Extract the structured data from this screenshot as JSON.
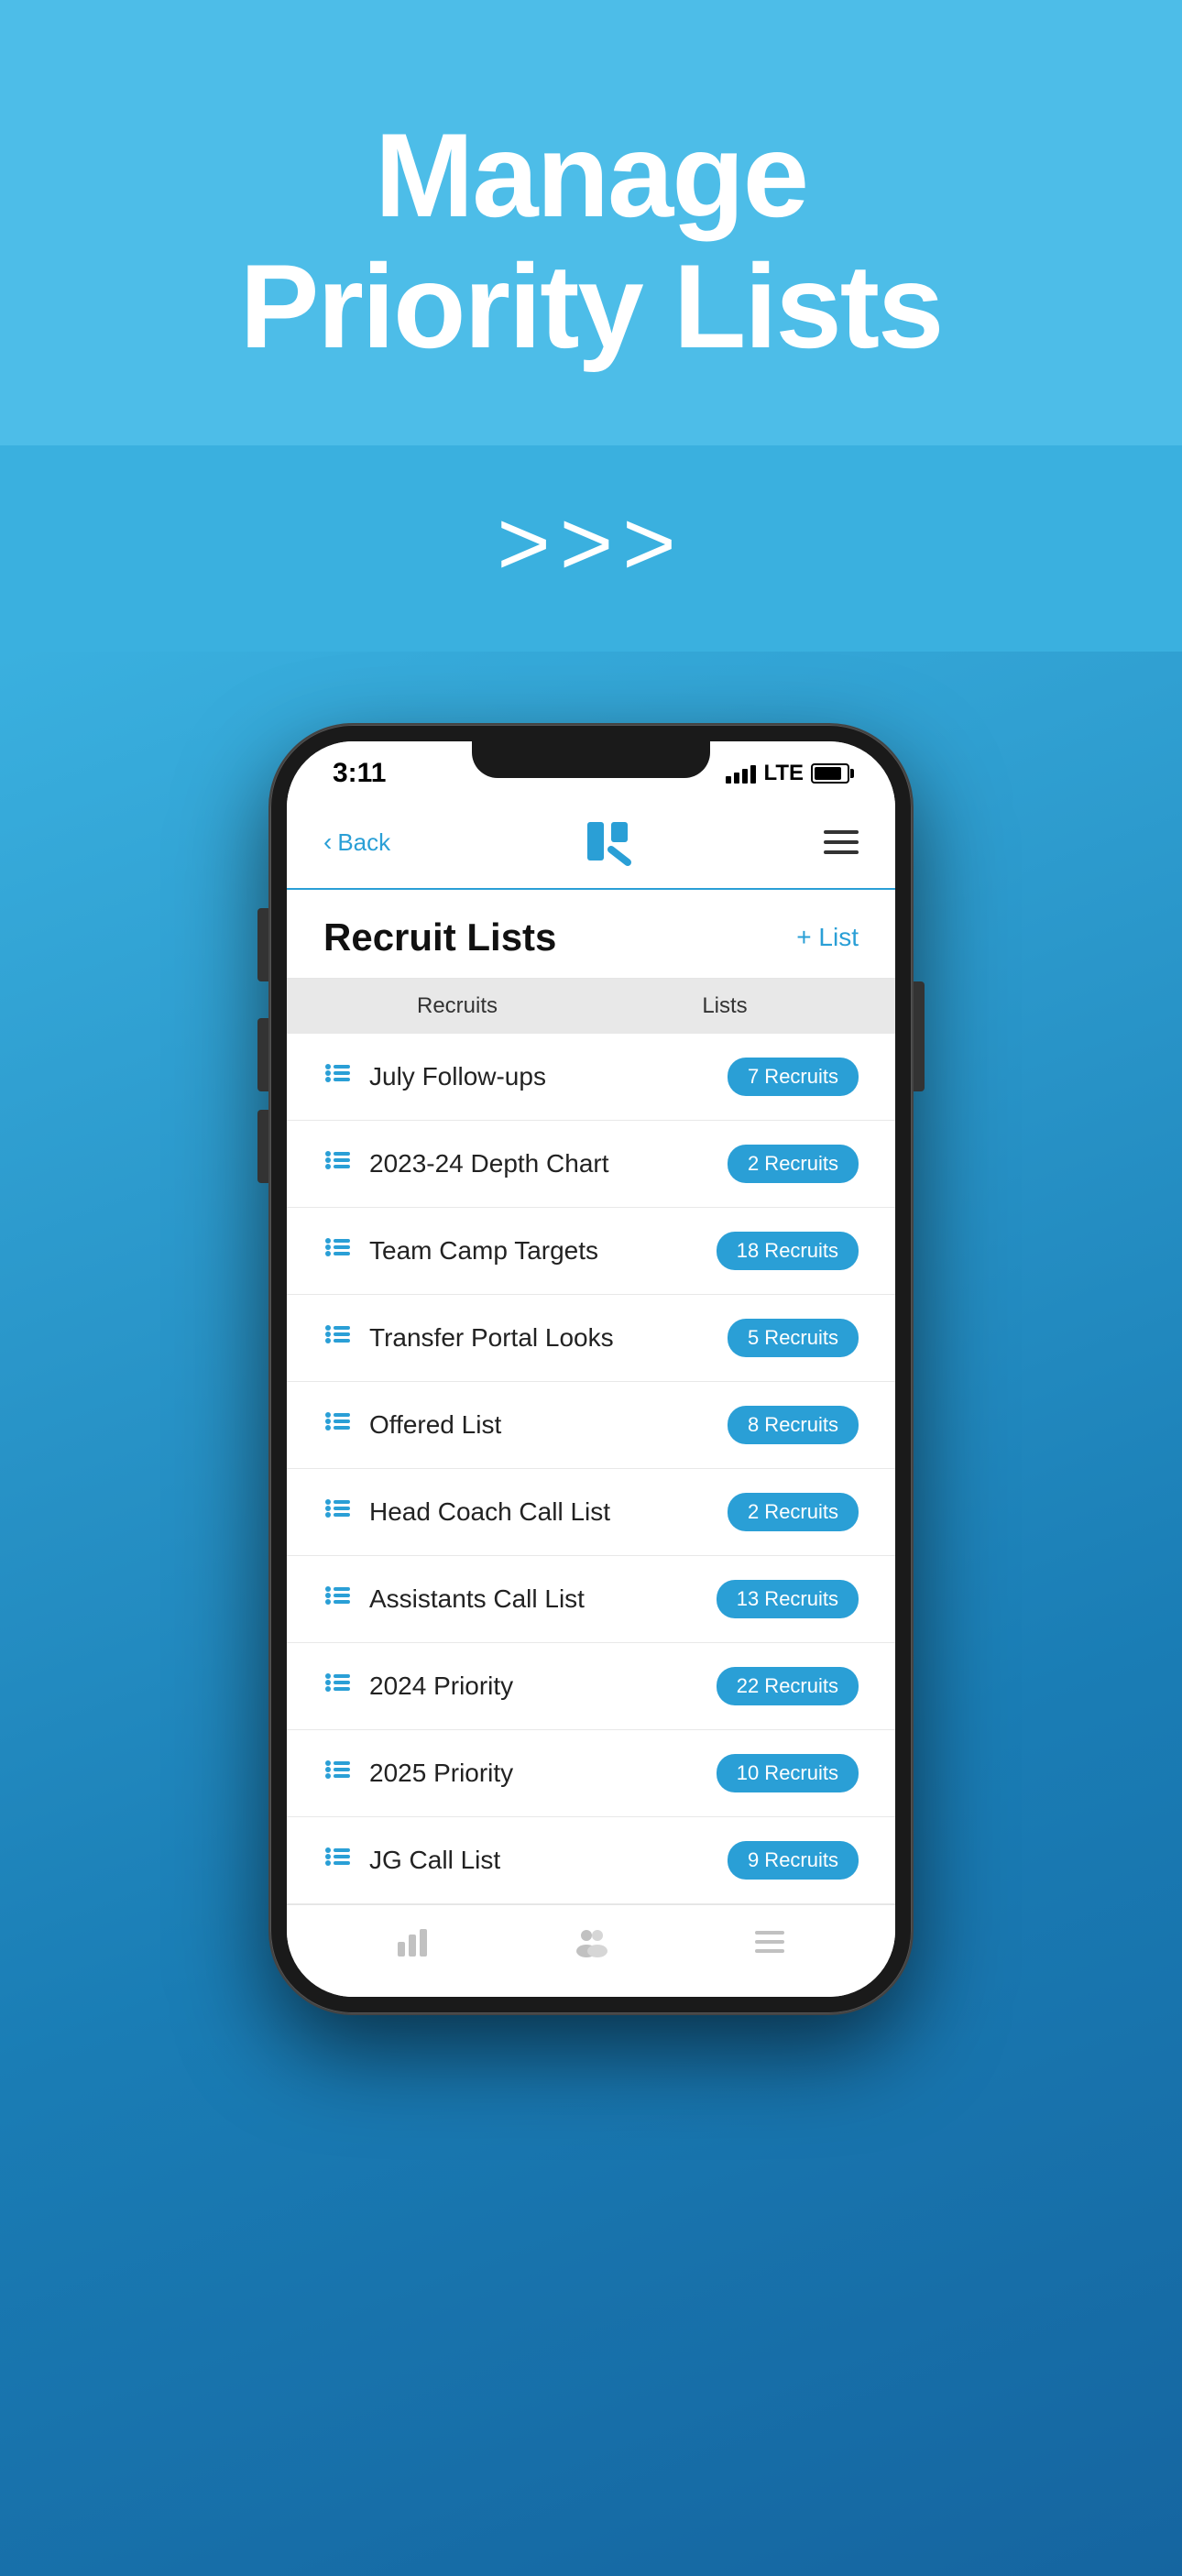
{
  "hero": {
    "title_line1": "Manage",
    "title_line2": "Priority Lists"
  },
  "arrows": ">>>",
  "status_bar": {
    "time": "3:11",
    "lte": "LTE"
  },
  "nav": {
    "back_label": "Back",
    "menu_label": "Menu"
  },
  "page": {
    "title": "Recruit Lists",
    "add_button": "+ List"
  },
  "table_headers": {
    "col1": "Recruits",
    "col2": "Lists"
  },
  "list_items": [
    {
      "name": "July Follow-ups",
      "badge": "7 Recruits"
    },
    {
      "name": "2023-24 Depth Chart",
      "badge": "2 Recruits"
    },
    {
      "name": "Team Camp Targets",
      "badge": "18 Recruits"
    },
    {
      "name": "Transfer Portal Looks",
      "badge": "5 Recruits"
    },
    {
      "name": "Offered List",
      "badge": "8 Recruits"
    },
    {
      "name": "Head Coach Call List",
      "badge": "2 Recruits"
    },
    {
      "name": "Assistants Call List",
      "badge": "13 Recruits"
    },
    {
      "name": "2024 Priority",
      "badge": "22 Recruits"
    },
    {
      "name": "2025 Priority",
      "badge": "10 Recruits"
    },
    {
      "name": "JG Call List",
      "badge": "9 Recruits"
    }
  ]
}
